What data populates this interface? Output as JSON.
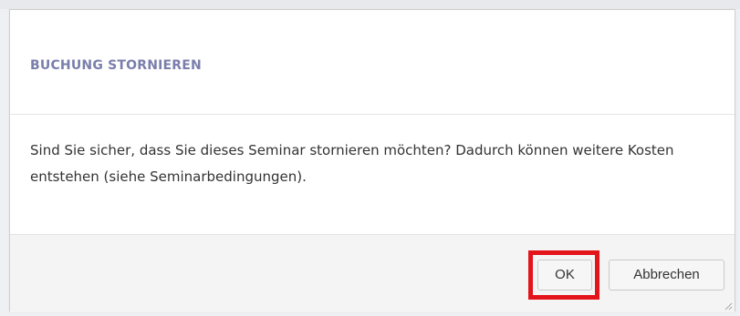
{
  "dialog": {
    "title": "BUCHUNG STORNIEREN",
    "message": "Sind Sie sicher, dass Sie dieses Seminar stornieren möchten? Dadurch können weitere Kosten entstehen (siehe Seminarbedingungen).",
    "buttons": {
      "ok_label": "OK",
      "cancel_label": "Abbrechen"
    }
  },
  "colors": {
    "title": "#7a7eab",
    "highlight": "#e4141b",
    "footer_background": "#f4f4f4",
    "text": "#333333"
  },
  "icons": {
    "resize": "resize-grip-icon"
  }
}
